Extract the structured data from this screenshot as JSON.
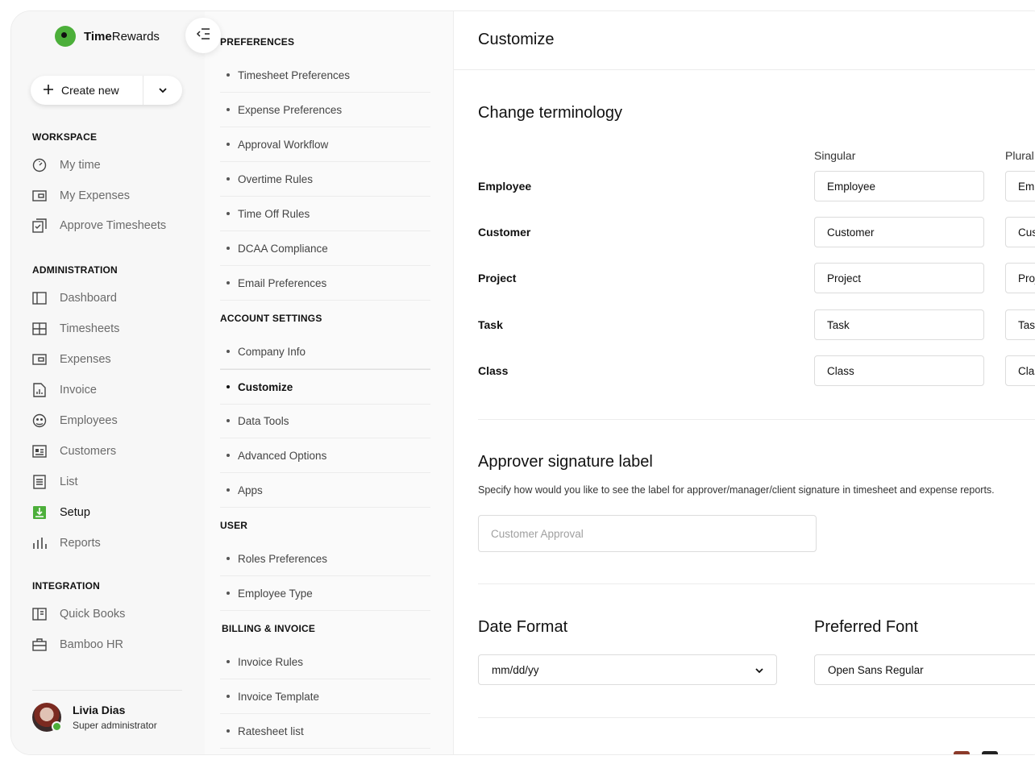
{
  "app": {
    "name_bold": "Time",
    "name_rest": "Rewards"
  },
  "create_button": {
    "label": "Create new"
  },
  "sidebar": {
    "workspace_title": "WORKSPACE",
    "workspace_items": [
      {
        "label": "My time",
        "icon": "clock-icon"
      },
      {
        "label": "My Expenses",
        "icon": "wallet-icon"
      },
      {
        "label": "Approve Timesheets",
        "icon": "checklist-icon"
      }
    ],
    "admin_title": "ADMINISTRATION",
    "admin_items": [
      {
        "label": "Dashboard",
        "icon": "dashboard-icon"
      },
      {
        "label": "Timesheets",
        "icon": "grid-icon"
      },
      {
        "label": "Expenses",
        "icon": "wallet-icon"
      },
      {
        "label": "Invoice",
        "icon": "invoice-icon"
      },
      {
        "label": "Employees",
        "icon": "employees-icon"
      },
      {
        "label": "Customers",
        "icon": "id-card-icon"
      },
      {
        "label": "List",
        "icon": "list-icon"
      },
      {
        "label": "Setup",
        "icon": "setup-icon",
        "active": true
      },
      {
        "label": "Reports",
        "icon": "bar-chart-icon"
      }
    ],
    "integration_title": "INTEGRATION",
    "integration_items": [
      {
        "label": "Quick Books",
        "icon": "book-icon"
      },
      {
        "label": "Bamboo HR",
        "icon": "briefcase-icon"
      }
    ]
  },
  "user": {
    "name": "Livia Dias",
    "role": "Super administrator"
  },
  "settings_menu": {
    "preferences_title": "PREFERENCES",
    "preferences": [
      "Timesheet Preferences",
      "Expense Preferences",
      "Approval Workflow",
      "Overtime Rules",
      "Time Off Rules",
      "DCAA Compliance",
      "Email Preferences"
    ],
    "account_title": "ACCOUNT SETTINGS",
    "account": [
      "Company Info",
      "Customize",
      "Data Tools",
      "Advanced Options",
      "Apps"
    ],
    "user_title": "USER",
    "user": [
      "Roles Preferences",
      "Employee Type"
    ],
    "billing_title": "BILLING & INVOICE",
    "billing": [
      "Invoice Rules",
      "Invoice Template",
      "Ratesheet list"
    ]
  },
  "main": {
    "title": "Customize",
    "terminology": {
      "heading": "Change terminology",
      "singular_header": "Singular",
      "plural_header": "Plural",
      "rows": [
        {
          "label": "Employee",
          "singular": "Employee",
          "plural": "Employees"
        },
        {
          "label": "Customer",
          "singular": "Customer",
          "plural": "Customers"
        },
        {
          "label": "Project",
          "singular": "Project",
          "plural": "Projects"
        },
        {
          "label": "Task",
          "singular": "Task",
          "plural": "Tasks"
        },
        {
          "label": "Class",
          "singular": "Class",
          "plural": "Classes"
        }
      ]
    },
    "approver": {
      "heading": "Approver signature label",
      "description": "Specify how would you like to see the label for approver/manager/client signature in timesheet and expense reports.",
      "placeholder": "Customer Approval"
    },
    "date_format": {
      "heading": "Date Format",
      "value": "mm/dd/yy"
    },
    "font": {
      "heading": "Preferred Font",
      "value": "Open Sans Regular"
    }
  },
  "colors": {
    "accent_green": "#4caf3a",
    "swatch_brown": "#8b3a2a",
    "swatch_black": "#222222"
  }
}
